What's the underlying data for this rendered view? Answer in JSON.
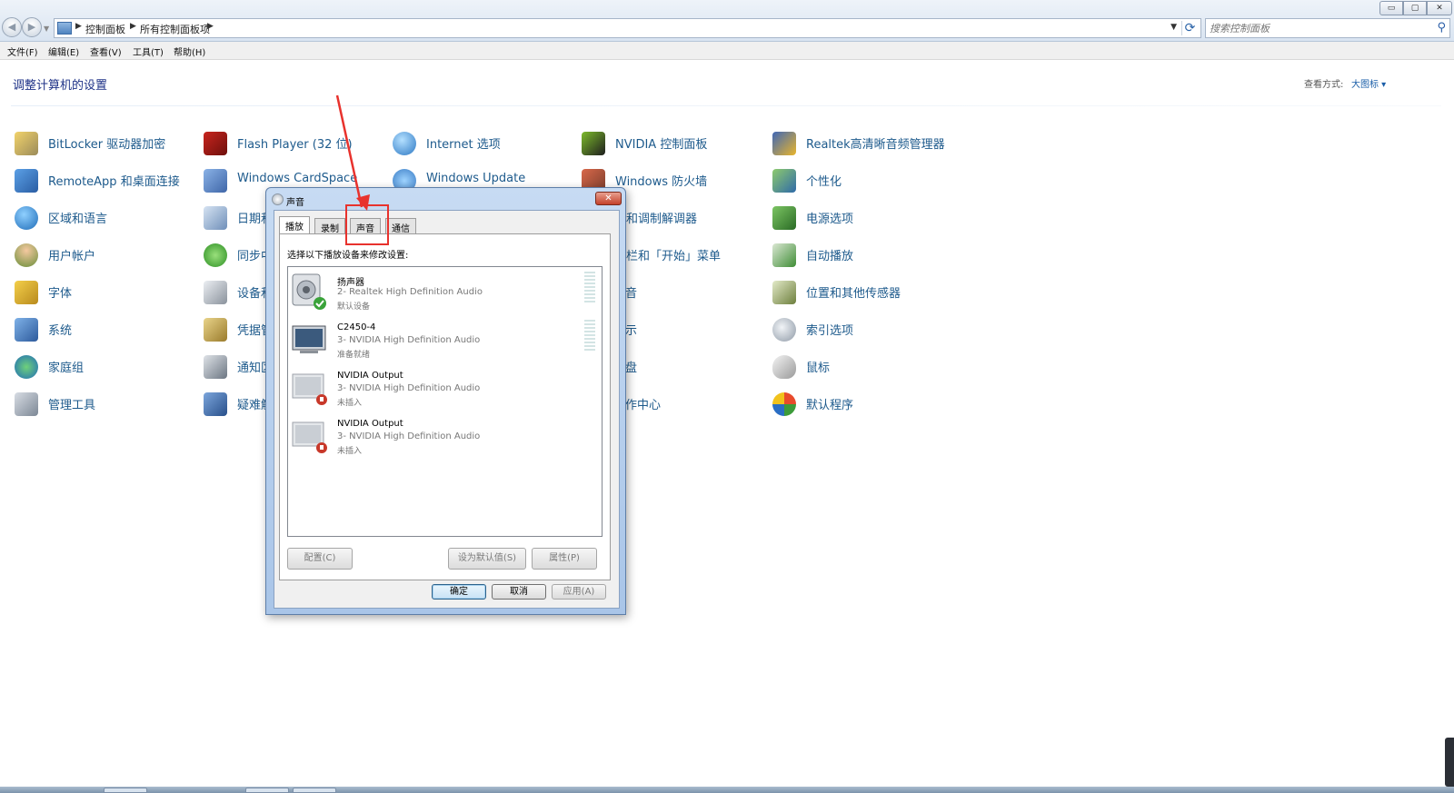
{
  "address_bar": {
    "segments": [
      "控制面板",
      "所有控制面板项"
    ],
    "search_placeholder": "搜索控制面板"
  },
  "window_controls": {
    "minimize": "▭",
    "maximize": "▢",
    "close": "✕"
  },
  "menu": [
    "文件(F)",
    "编辑(E)",
    "查看(V)",
    "工具(T)",
    "帮助(H)"
  ],
  "content": {
    "heading": "调整计算机的设置",
    "view_by_label": "查看方式:",
    "view_by_value": "大图标 ▾"
  },
  "items": {
    "col1": [
      "BitLocker 驱动器加密",
      "RemoteApp 和桌面连接",
      "区域和语言",
      "用户帐户",
      "字体",
      "系统",
      "家庭组",
      "管理工具"
    ],
    "col2": [
      "Flash Player (32 位)",
      "Windows CardSpace",
      "日期和",
      "同步中",
      "设备和",
      "凭据管",
      "通知区",
      "疑难解"
    ],
    "col3": [
      "Internet 选项",
      "Windows Update"
    ],
    "col4": [
      "NVIDIA 控制面板",
      "Windows 防火墙",
      "话和调制解调器",
      "务栏和「开始」菜单",
      "音",
      "示",
      "盘",
      "作中心"
    ],
    "col5": [
      "Realtek高清晰音频管理器",
      "个性化",
      "电源选项",
      "自动播放",
      "位置和其他传感器",
      "索引选项",
      "鼠标",
      "默认程序"
    ]
  },
  "colors": {
    "link": "#1d5a8c",
    "heading": "#1e3287",
    "annotation": "#e8322d"
  },
  "dialog": {
    "title": "声音",
    "close_label": "✕",
    "tabs": [
      "播放",
      "录制",
      "声音",
      "通信"
    ],
    "prompt": "选择以下播放设备来修改设置:",
    "devices": [
      {
        "name": "扬声器",
        "desc": "2- Realtek High Definition Audio",
        "status": "默认设备",
        "icon": "speaker-icon"
      },
      {
        "name": "C2450-4",
        "desc": "3- NVIDIA High Definition Audio",
        "status": "准备就绪",
        "icon": "monitor-icon"
      },
      {
        "name": "NVIDIA Output",
        "desc": "3- NVIDIA High Definition Audio",
        "status": "未插入",
        "icon": "monitor-icon"
      },
      {
        "name": "NVIDIA Output",
        "desc": "3- NVIDIA High Definition Audio",
        "status": "未插入",
        "icon": "monitor-icon"
      }
    ],
    "buttons": {
      "configure": "配置(C)",
      "set_default": "设为默认值(S)",
      "properties": "属性(P)",
      "ok": "确定",
      "cancel": "取消",
      "apply": "应用(A)"
    }
  }
}
